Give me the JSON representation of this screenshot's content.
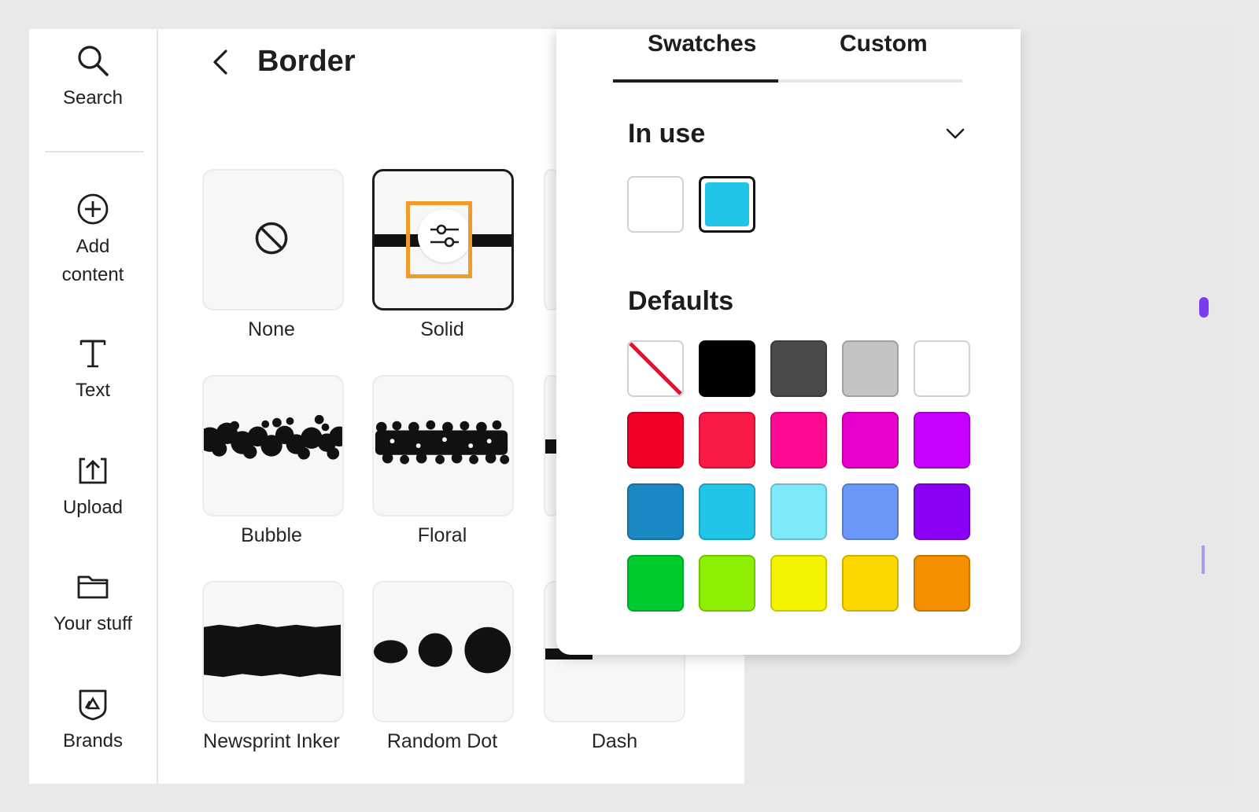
{
  "rail": {
    "items": [
      {
        "label": "Search",
        "icon": "search-icon"
      },
      {
        "label": "Add\ncontent",
        "icon": "plus-circle-icon"
      },
      {
        "label": "Text",
        "icon": "text-icon"
      },
      {
        "label": "Upload",
        "icon": "upload-icon"
      },
      {
        "label": "Your stuff",
        "icon": "folder-icon"
      },
      {
        "label": "Brands",
        "icon": "brands-icon"
      }
    ]
  },
  "border_panel": {
    "title": "Border",
    "styles": [
      {
        "label": "None"
      },
      {
        "label": "Solid",
        "selected": true
      },
      {
        "label": "Bubble"
      },
      {
        "label": "Floral"
      },
      {
        "label": "Newsprint Inker"
      },
      {
        "label": "Random Dot"
      },
      {
        "label": "Dash"
      }
    ]
  },
  "color_popover": {
    "tabs": [
      {
        "label": "Swatches",
        "active": true
      },
      {
        "label": "Custom",
        "active": false
      }
    ],
    "in_use": {
      "title": "In use",
      "colors": [
        "#ffffff",
        "#22c4e8"
      ],
      "selected_index": 1
    },
    "defaults": {
      "title": "Defaults",
      "rows": [
        [
          "none",
          "#000000",
          "#4a4a4a",
          "#c4c4c4",
          "#ffffff"
        ],
        [
          "#f20028",
          "#fa1a46",
          "#ff0a94",
          "#e800cc",
          "#c800ff"
        ],
        [
          "#1a88c2",
          "#22c4e8",
          "#7eeaf8",
          "#6a97f8",
          "#8a00f4"
        ],
        [
          "#00cc30",
          "#8ef000",
          "#f4f400",
          "#fcd800",
          "#f49000"
        ]
      ]
    }
  },
  "colors": {
    "accent_highlight": "#f29a27",
    "selected_border": "#1c1c1c"
  }
}
